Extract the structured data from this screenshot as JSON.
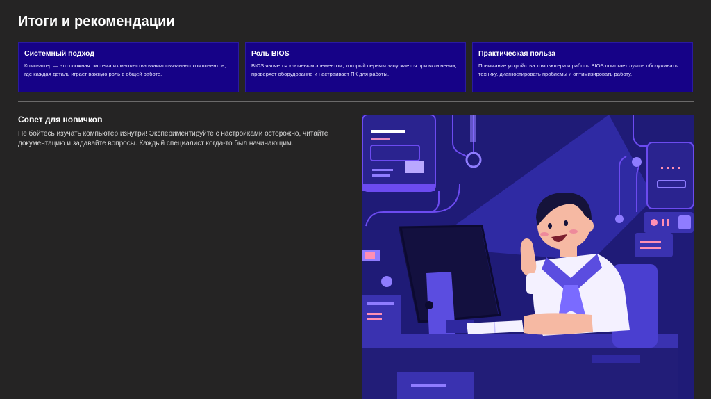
{
  "page": {
    "title": "Итоги и рекомендации"
  },
  "cards": [
    {
      "heading": "Системный подход",
      "text": "Компьютер — это сложная система из множества взаимосвязанных компонентов, где каждая деталь играет важную роль в общей работе."
    },
    {
      "heading": "Роль BIOS",
      "text": "BIOS является ключевым элементом, который первым запускается при включении, проверяет оборудование и настраивает ПК для работы."
    },
    {
      "heading": "Практическая польза",
      "text": "Понимание устройства компьютера и работы BIOS помогает лучше обслуживать технику, диагностировать проблемы и оптимизировать работу."
    }
  ],
  "tip": {
    "heading": "Совет для новичков",
    "text": "Не бойтесь изучать компьютер изнутри! Экспериментируйте с настройками осторожно, читайте документацию и задавайте вопросы. Каждый специалист когда-то был начинающим."
  },
  "colors": {
    "background": "#252424",
    "card": "#160287",
    "illustration_bg": "#1c1a6e",
    "accent_purple": "#7a5cff"
  }
}
